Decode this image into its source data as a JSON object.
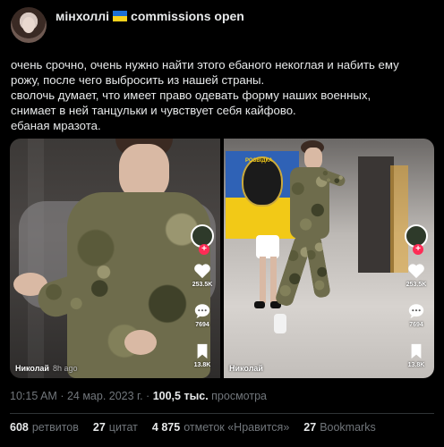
{
  "author": {
    "display_name_prefix": "мінхоллі",
    "display_name_suffix": "commissions open",
    "flag_colors": [
      "#1d6fd3",
      "#f8d21c"
    ]
  },
  "tweet": {
    "lines": [
      "очень срочно, очень нужно найти этого ебаного некоглая и набить ему",
      "рожу, после чего выбросить из нашей страны.",
      "сволочь думает, что имеет право одевать форму наших военных,",
      "снимает в ней танцульки и чувствует себя кайфово.",
      "ебаная мразота."
    ]
  },
  "media": {
    "left_clip": {
      "likes": "253.5K",
      "comments": "7694",
      "saves": "13.8K",
      "username": "Николай",
      "time_hint": "8h ago"
    },
    "right_clip": {
      "flag_text": "РОЗВІДКА",
      "likes": "253.5K",
      "comments": "7694",
      "saves": "13.8K",
      "username": "Николай"
    },
    "accent": "#fe2c55"
  },
  "meta": {
    "time": "10:15 AM",
    "date": "24 мар. 2023 г.",
    "views": "100,5 тыс.",
    "views_label": "просмотра"
  },
  "stats": [
    {
      "num": "608",
      "label": "ретвитов"
    },
    {
      "num": "27",
      "label": "цитат"
    },
    {
      "num": "4 875",
      "label": "отметок «Нравится»"
    },
    {
      "num": "27",
      "label": "Bookmarks"
    }
  ]
}
